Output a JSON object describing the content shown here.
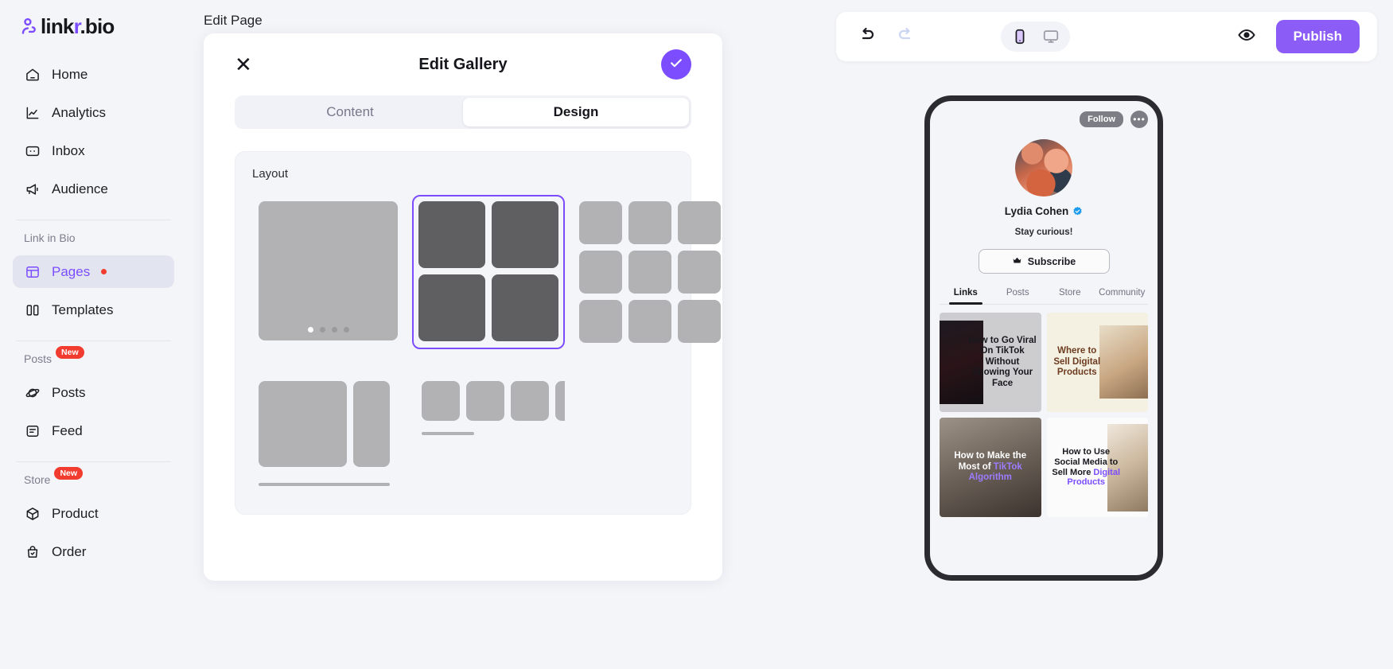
{
  "brand": {
    "name_prefix": "link",
    "name_accent": "r",
    "name_suffix": ".bio",
    "logo_icon": "person-link-icon",
    "accent_color": "#7c4dff"
  },
  "sidebar": {
    "groups": [
      {
        "label": "",
        "badge": "",
        "items": [
          {
            "label": "Home",
            "icon": "home-icon",
            "active": false,
            "badge": ""
          },
          {
            "label": "Analytics",
            "icon": "chart-line-icon",
            "active": false,
            "badge": ""
          },
          {
            "label": "Inbox",
            "icon": "inbox-chat-icon",
            "active": false,
            "badge": ""
          },
          {
            "label": "Audience",
            "icon": "megaphone-icon",
            "active": false,
            "badge": ""
          }
        ]
      },
      {
        "label": "Link in Bio",
        "badge": "",
        "items": [
          {
            "label": "Pages",
            "icon": "layout-panel-icon",
            "active": true,
            "badge": "dot"
          },
          {
            "label": "Templates",
            "icon": "columns-icon",
            "active": false,
            "badge": ""
          }
        ]
      },
      {
        "label": "Posts",
        "badge": "New",
        "items": [
          {
            "label": "Posts",
            "icon": "planet-icon",
            "active": false,
            "badge": ""
          },
          {
            "label": "Feed",
            "icon": "feed-doc-icon",
            "active": false,
            "badge": ""
          }
        ]
      },
      {
        "label": "Store",
        "badge": "New",
        "items": [
          {
            "label": "Product",
            "icon": "box-icon",
            "active": false,
            "badge": ""
          },
          {
            "label": "Order",
            "icon": "bag-check-icon",
            "active": false,
            "badge": ""
          }
        ]
      }
    ]
  },
  "main": {
    "page_title": "Edit Page"
  },
  "modal": {
    "title": "Edit Gallery",
    "close_icon": "close-icon",
    "confirm_icon": "check-icon",
    "tabs": [
      {
        "label": "Content",
        "active": false
      },
      {
        "label": "Design",
        "active": true
      }
    ],
    "layout_section": {
      "label": "Layout",
      "options": [
        {
          "name": "carousel-single",
          "selected": false,
          "dots": 4,
          "active_dot": 0
        },
        {
          "name": "grid-2x2",
          "selected": true,
          "cells": 4
        },
        {
          "name": "grid-3x3",
          "selected": false,
          "cells": 9
        },
        {
          "name": "wide-pair",
          "selected": false
        },
        {
          "name": "thumbnail-strip",
          "selected": false
        }
      ]
    }
  },
  "toolbar": {
    "undo_icon": "undo-icon",
    "undo_enabled": true,
    "redo_icon": "redo-icon",
    "redo_enabled": false,
    "devices": [
      {
        "name": "mobile-icon",
        "active": true
      },
      {
        "name": "desktop-icon",
        "active": false
      }
    ],
    "preview_icon": "eye-icon",
    "publish_label": "Publish",
    "publish_color": "#8b5cf6"
  },
  "preview": {
    "follow_label": "Follow",
    "more_label": "•••",
    "avatar_icon": "profile-avatar",
    "display_name": "Lydia Cohen",
    "verified_icon": "verified-badge-icon",
    "bio": "Stay curious!",
    "subscribe_label": "Subscribe",
    "subscribe_icon": "crown-icon",
    "tabs": [
      {
        "label": "Links",
        "active": true
      },
      {
        "label": "Posts",
        "active": false
      },
      {
        "label": "Store",
        "active": false
      },
      {
        "label": "Community",
        "active": false
      }
    ],
    "gallery": [
      {
        "title": "How to Go Viral On TikTok Without Showing Your Face",
        "highlight": ""
      },
      {
        "title": "Where to Sell Digital Products",
        "highlight": ""
      },
      {
        "title_plain": "How to Make the Most of ",
        "highlight": "TikTok Algorithm"
      },
      {
        "title_plain": "How to Use Social Media to Sell More ",
        "highlight": "Digital Products"
      }
    ]
  }
}
